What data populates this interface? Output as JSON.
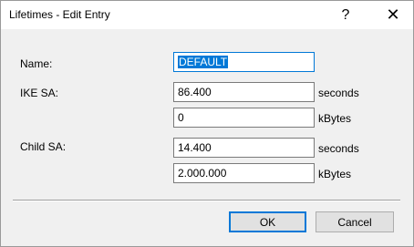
{
  "window": {
    "title": "Lifetimes - Edit Entry",
    "help_glyph": "?",
    "close_glyph": "✕"
  },
  "form": {
    "name_label": "Name:",
    "name_value": "DEFAULT",
    "ike_label": "IKE SA:",
    "ike_seconds": "86.400",
    "ike_kbytes": "0",
    "child_label": "Child SA:",
    "child_seconds": "14.400",
    "child_kbytes": "2.000.000",
    "unit_seconds": "seconds",
    "unit_kbytes": "kBytes"
  },
  "buttons": {
    "ok": "OK",
    "cancel": "Cancel"
  },
  "colors": {
    "accent": "#0078d7",
    "dialog_bg": "#f0f0f0"
  }
}
